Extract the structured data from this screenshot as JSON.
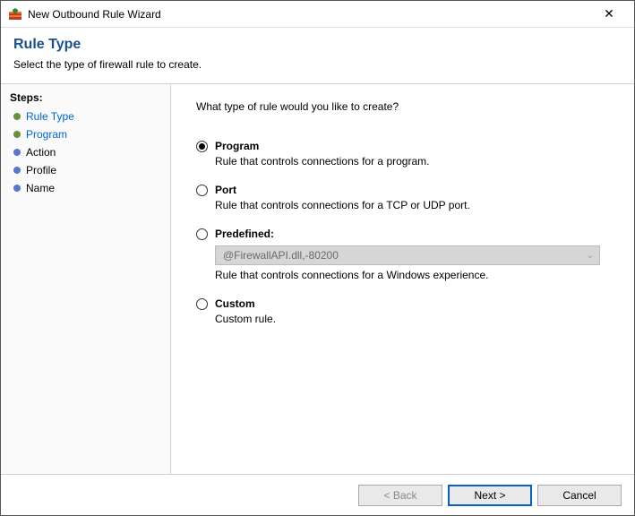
{
  "window": {
    "title": "New Outbound Rule Wizard"
  },
  "header": {
    "title": "Rule Type",
    "subtitle": "Select the type of firewall rule to create."
  },
  "steps": {
    "heading": "Steps:",
    "items": [
      {
        "label": "Rule Type",
        "state": "current"
      },
      {
        "label": "Program",
        "state": "current"
      },
      {
        "label": "Action",
        "state": "pending"
      },
      {
        "label": "Profile",
        "state": "pending"
      },
      {
        "label": "Name",
        "state": "pending"
      }
    ]
  },
  "content": {
    "question": "What type of rule would you like to create?",
    "options": [
      {
        "key": "program",
        "label": "Program",
        "desc": "Rule that controls connections for a program.",
        "selected": true
      },
      {
        "key": "port",
        "label": "Port",
        "desc": "Rule that controls connections for a TCP or UDP port.",
        "selected": false
      },
      {
        "key": "predefined",
        "label": "Predefined:",
        "desc": "Rule that controls connections for a Windows experience.",
        "selected": false,
        "combo_value": "@FirewallAPI.dll,-80200",
        "combo_enabled": false
      },
      {
        "key": "custom",
        "label": "Custom",
        "desc": "Custom rule.",
        "selected": false
      }
    ]
  },
  "footer": {
    "back": "< Back",
    "next": "Next >",
    "cancel": "Cancel",
    "back_enabled": false
  }
}
